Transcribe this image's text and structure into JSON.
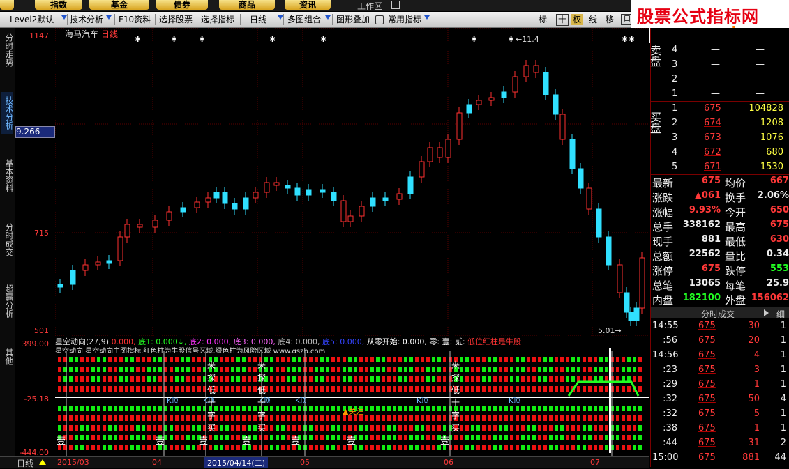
{
  "top_tabs": [
    "指数",
    "基金",
    "债券",
    "商品",
    "资讯",
    "工作区"
  ],
  "toolbar": {
    "items": [
      "Level2默认",
      "技术分析",
      "F10资料",
      "选择股票",
      "选择指标",
      "日线",
      "多图组合",
      "图形叠加",
      "常用指标"
    ],
    "right_icons": [
      "标",
      "十",
      "权",
      "线",
      "移",
      "口"
    ]
  },
  "left_tabs": [
    "分时走势",
    "技术分析",
    "基本资料",
    "分时成交",
    "超赢分析",
    "其他"
  ],
  "logo": {
    "title": "股票公式指标网",
    "url": "www.gszb.com"
  },
  "main_chart": {
    "stock_name": "海马汽车",
    "period": "日线",
    "y_labels": [
      "1147",
      "715",
      "501"
    ],
    "cursor_value": "9.266",
    "high_marker": "11.4",
    "low_marker": "5.01"
  },
  "sub_chart": {
    "indicator_name": "星空动向",
    "params": "(27,9)",
    "values": [
      {
        "label": "0.000,",
        "color": "#ff3333"
      },
      {
        "label": "底1: 0.000↓,",
        "color": "#22ff22"
      },
      {
        "label": "底2: 0.000,",
        "color": "#ff33ff"
      },
      {
        "label": "底3: 0.000,",
        "color": "#ff66ff"
      },
      {
        "label": "底4: 0.000,",
        "color": "#bbbbbb"
      },
      {
        "label": "底5: 0.000,",
        "color": "#3344ff"
      },
      {
        "label": "从零开始: 0.000,",
        "color": "#ffffff"
      },
      {
        "label": "零: 壹: 贰:",
        "color": "#ffffff"
      },
      {
        "label": "低位红柱是牛股",
        "color": "#ff3333"
      }
    ],
    "subtitle": "星空动向 星空动向主图指标,红色柱为牛股信号区域,绿色柱为风险区域 www.gszb.com",
    "y_labels": [
      "399.00",
      "-25.18",
      "-444.00"
    ],
    "vertical_text": [
      "来",
      "探",
      "低",
      "十",
      "字",
      "买"
    ],
    "markers": [
      "壹",
      "贰",
      "K顶",
      "关注"
    ]
  },
  "order_book": {
    "sell_label": "卖盘",
    "buy_label": "买盘",
    "sell": [
      {
        "level": "4",
        "price": "—",
        "vol": "—"
      },
      {
        "level": "3",
        "price": "—",
        "vol": "—"
      },
      {
        "level": "2",
        "price": "—",
        "vol": "—"
      },
      {
        "level": "1",
        "price": "—",
        "vol": "—"
      }
    ],
    "buy": [
      {
        "level": "1",
        "price": "675",
        "vol": "104828"
      },
      {
        "level": "2",
        "price": "674",
        "vol": "1208"
      },
      {
        "level": "3",
        "price": "673",
        "vol": "1076"
      },
      {
        "level": "4",
        "price": "672",
        "vol": "680"
      },
      {
        "level": "5",
        "price": "671",
        "vol": "1530"
      }
    ]
  },
  "quote": [
    {
      "l1": "最新",
      "v1": "675",
      "c1": "red",
      "l2": "均价",
      "v2": "667",
      "c2": "red"
    },
    {
      "l1": "涨跌",
      "v1": "▲061",
      "c1": "red",
      "l2": "换手",
      "v2": "2.06%",
      "c2": "white"
    },
    {
      "l1": "涨幅",
      "v1": "9.93%",
      "c1": "red",
      "l2": "今开",
      "v2": "650",
      "c2": "red"
    },
    {
      "l1": "总手",
      "v1": "338162",
      "c1": "white",
      "l2": "最高",
      "v2": "675",
      "c2": "red"
    },
    {
      "l1": "现手",
      "v1": "881",
      "c1": "white",
      "l2": "最低",
      "v2": "630",
      "c2": "red"
    },
    {
      "l1": "总额",
      "v1": "22562",
      "c1": "white",
      "l2": "量比",
      "v2": "0.34",
      "c2": "white"
    },
    {
      "l1": "涨停",
      "v1": "675",
      "c1": "red",
      "l2": "跌停",
      "v2": "553",
      "c2": "green"
    },
    {
      "l1": "总笔",
      "v1": "13065",
      "c1": "white",
      "l2": "每笔",
      "v2": "25.9",
      "c2": "white"
    },
    {
      "l1": "内盘",
      "v1": "182100",
      "c1": "green",
      "l2": "外盘",
      "v2": "156062",
      "c2": "red"
    }
  ],
  "ticks_header": "分时成交",
  "ticks_tab": "细",
  "ticks": [
    {
      "time": "14:55",
      "price": "675",
      "vol": "30",
      "n": "1"
    },
    {
      "time": ":56",
      "price": "675",
      "vol": "20",
      "n": "1"
    },
    {
      "time": "14:56",
      "price": "675",
      "vol": "4",
      "n": "1"
    },
    {
      "time": ":23",
      "price": "675",
      "vol": "3",
      "n": "1"
    },
    {
      "time": ":29",
      "price": "675",
      "vol": "1",
      "n": "1"
    },
    {
      "time": ":32",
      "price": "675",
      "vol": "50",
      "n": "4"
    },
    {
      "time": ":32",
      "price": "675",
      "vol": "5",
      "n": "1"
    },
    {
      "time": ":38",
      "price": "675",
      "vol": "1",
      "n": "1"
    },
    {
      "time": ":44",
      "price": "675",
      "vol": "31",
      "n": "2"
    },
    {
      "time": "15:00",
      "price": "675",
      "vol": "881",
      "n": "44"
    }
  ],
  "bottom": {
    "period": "日线",
    "dates": [
      "2015/03",
      "04",
      "2015/04/14(二)",
      "05",
      "06",
      "07"
    ]
  }
}
